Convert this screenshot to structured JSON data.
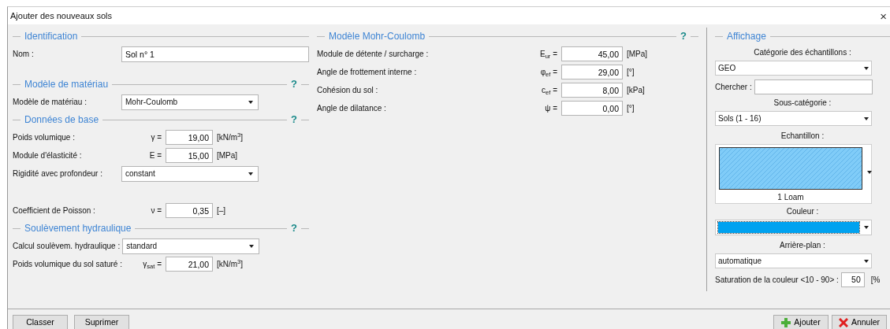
{
  "window": {
    "title": "Ajouter des nouveaux sols",
    "close": "×"
  },
  "left_sections": [
    {
      "title": "Identification",
      "rows": [
        {
          "kind": "text",
          "label": "Nom :",
          "value": "Sol n° 1"
        }
      ]
    },
    {
      "title": "Modèle de matériau",
      "help": "?",
      "rows": [
        {
          "kind": "select",
          "label": "Modèle de matériau :",
          "value": "Mohr-Coulomb"
        }
      ]
    },
    {
      "title": "Données de base",
      "help": "?",
      "rows": [
        {
          "kind": "number",
          "label": "Poids volumique :",
          "symbol": "γ =",
          "value": "19,00",
          "unit": "[kN/m$^{3}$]"
        },
        {
          "kind": "number",
          "label": "Module d'élasticité :",
          "symbol": "E =",
          "value": "15,00",
          "unit": "[MPa]"
        },
        {
          "kind": "select",
          "label": "Rigidité avec profondeur :",
          "value": "constant"
        },
        {
          "kind": "number",
          "label": "Coefficient de Poisson :",
          "symbol": "ν =",
          "value": "0,35",
          "unit": "[–]"
        }
      ]
    },
    {
      "title": "Soulèvement hydraulique",
      "help": "?",
      "rows": [
        {
          "kind": "select",
          "label": "Calcul soulèvem. hydraulique :",
          "value": "standard"
        },
        {
          "kind": "number",
          "label": "Poids volumique du sol saturé :",
          "symbol": "γ$_{sat}$ =",
          "value": "21,00",
          "unit": "[kN/m$^{3}$]"
        }
      ]
    }
  ],
  "middle_section": {
    "title": "Modèle Mohr-Coulomb",
    "help": "?",
    "rows": [
      {
        "kind": "number",
        "label": "Module de détente / surcharge :",
        "symbol": "E$_{ur}$ =",
        "value": "45,00",
        "unit": "[MPa]"
      },
      {
        "kind": "number",
        "label": "Angle de frottement interne :",
        "symbol": "φ$_{ef}$ =",
        "value": "29,00",
        "unit": "[°]"
      },
      {
        "kind": "number",
        "label": "Cohésion du sol :",
        "symbol": "c$_{ef}$ =",
        "value": "8,00",
        "unit": "[kPa]"
      },
      {
        "kind": "number",
        "label": "Angle de dilatance :",
        "symbol": "ψ =",
        "value": "0,00",
        "unit": "[°]"
      }
    ]
  },
  "display": {
    "title": "Affichage",
    "category_label": "Catégorie des échantillons :",
    "category": "GEO",
    "search_label": "Chercher :",
    "subcategory_label": "Sous-catégorie :",
    "subcategory": "Sols (1 - 16)",
    "sample_label": "Echantillon :",
    "sample_name": "1 Loam",
    "color_label": "Couleur :",
    "color": "#00a2f0",
    "background_label": "Arrière-plan :",
    "background": "automatique",
    "saturation_label": "Saturation de la couleur <10 - 90> :",
    "saturation": "50",
    "saturation_unit": "[%"
  },
  "buttons_left": [
    "Classer",
    "Suprimer"
  ],
  "buttons_right": [
    {
      "kind": "add",
      "label": "Ajouter"
    },
    {
      "kind": "cancel",
      "label": "Annuler"
    }
  ]
}
